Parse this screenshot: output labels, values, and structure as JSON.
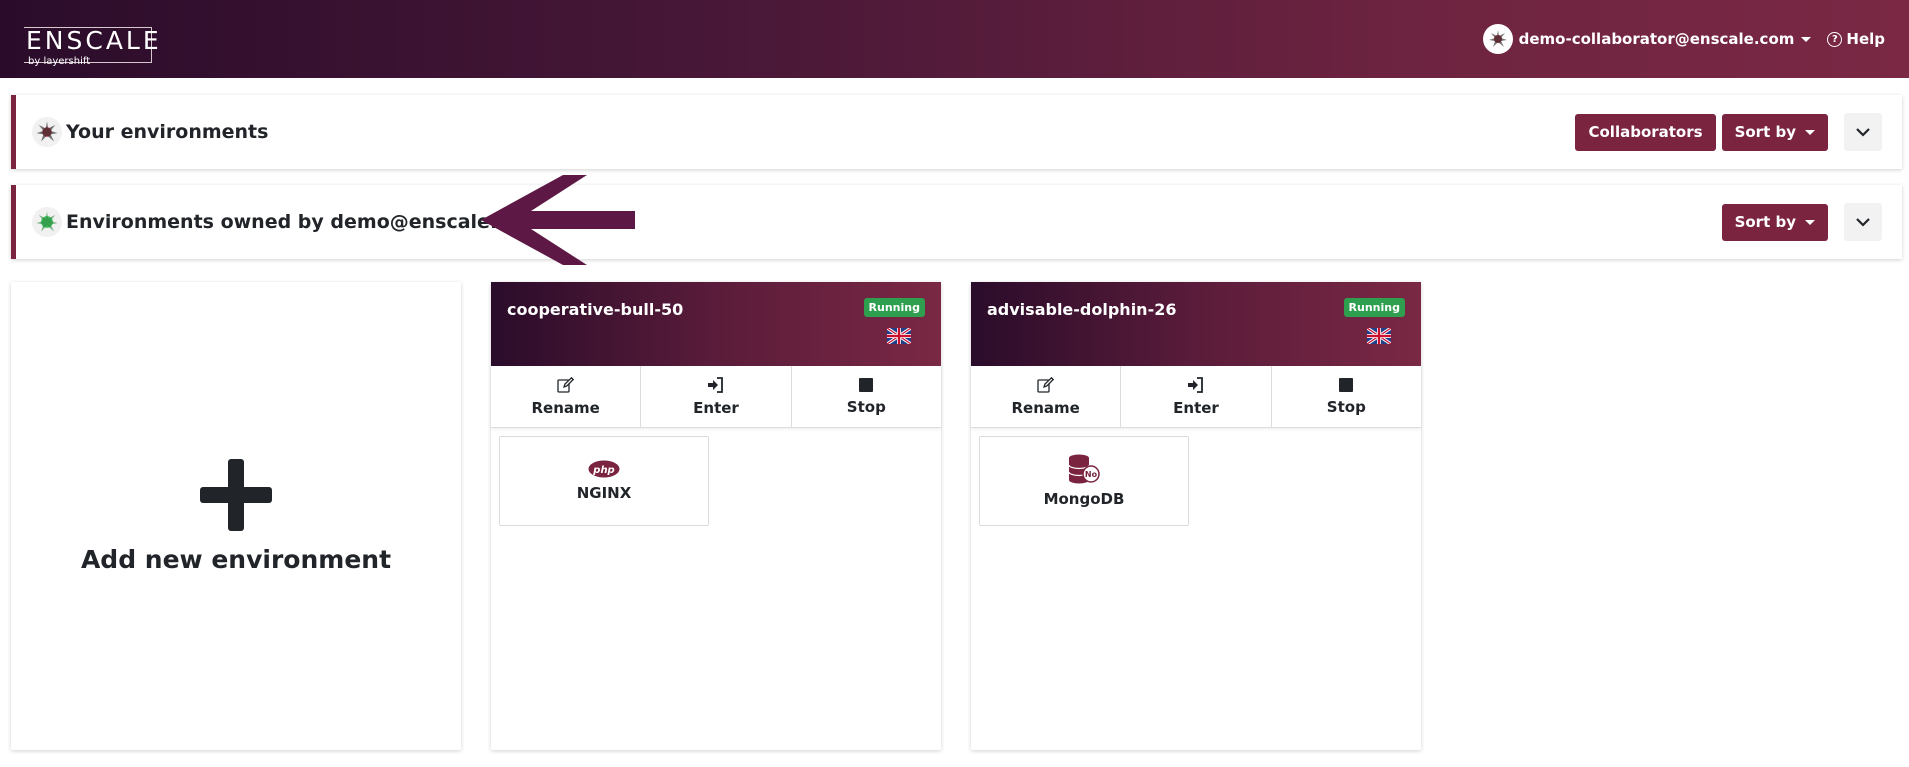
{
  "header": {
    "brand_name": "ENSCALE",
    "brand_sub": "by layershift",
    "user_email": "demo-collaborator@enscale.com",
    "help_label": "Help"
  },
  "sections": [
    {
      "title": "Your environments",
      "collaborators_label": "Collaborators",
      "sort_label": "Sort by"
    },
    {
      "title": "Environments owned by demo@enscale.com",
      "sort_label": "Sort by"
    }
  ],
  "add_environment": {
    "label": "Add new environment"
  },
  "environments": [
    {
      "name": "cooperative-bull-50",
      "status": "Running",
      "region_icon": "uk-flag-icon",
      "actions": [
        "Rename",
        "Enter",
        "Stop"
      ],
      "node": {
        "label": "NGINX",
        "icon": "php-icon",
        "icon_text": "php"
      }
    },
    {
      "name": "advisable-dolphin-26",
      "status": "Running",
      "region_icon": "uk-flag-icon",
      "actions": [
        "Rename",
        "Enter",
        "Stop"
      ],
      "node": {
        "label": "MongoDB",
        "icon": "database-icon",
        "icon_text": "No"
      }
    }
  ],
  "colors": {
    "accent": "#7a2440",
    "header_dark": "#2a0c2a",
    "status_running": "#2e9e4f",
    "annotation_arrow": "#5e1845"
  }
}
